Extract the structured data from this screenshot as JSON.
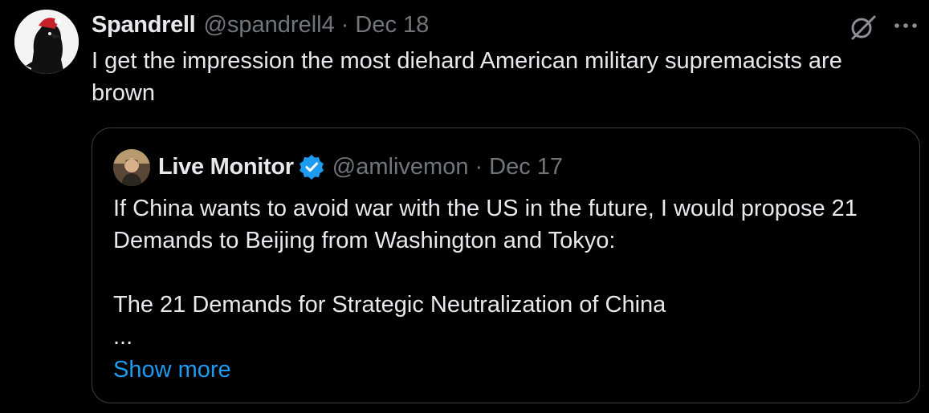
{
  "tweet": {
    "author_name": "Spandrell",
    "handle": "@spandrell4",
    "separator": "·",
    "date": "Dec 18",
    "text": "I get the impression the most diehard American military supremacists are brown"
  },
  "quoted_tweet": {
    "author_name": "Live Monitor",
    "handle": "@amlivemon",
    "separator": "·",
    "date": "Dec 17",
    "text": "If China wants to avoid war with the US in the future, I would propose 21 Demands to Beijing from Washington and Tokyo:\n\nThe 21 Demands for Strategic Neutralization of China\n...",
    "show_more": "Show more"
  },
  "icons": {
    "grok": "grok-icon",
    "more": "more-options-icon",
    "verified": "verified-badge-icon"
  },
  "colors": {
    "background": "#000000",
    "text": "#e7e9ea",
    "muted": "#71767b",
    "link": "#1d9bf0",
    "border": "#3a3f44"
  }
}
